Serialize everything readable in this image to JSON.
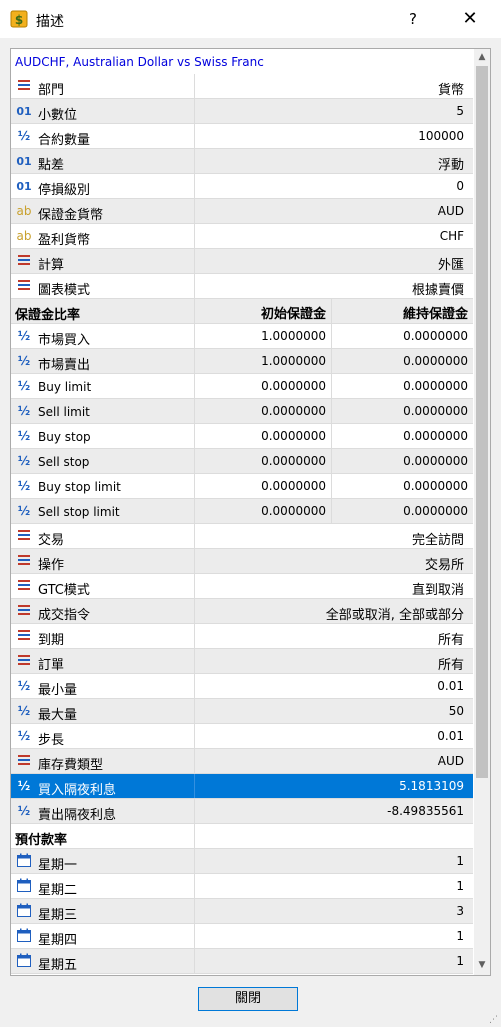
{
  "window": {
    "title": "描述",
    "help": "?",
    "close": "✕"
  },
  "symbol_header": "AUDCHF, Australian Dollar vs Swiss Franc",
  "rows_top": [
    {
      "icon": "list-icon",
      "label": "部門",
      "value": "貨幣"
    },
    {
      "icon": "integer-icon",
      "label": "小數位",
      "value": "5"
    },
    {
      "icon": "fraction-icon",
      "label": "合約數量",
      "value": "100000"
    },
    {
      "icon": "integer-icon",
      "label": "點差",
      "value": "浮動"
    },
    {
      "icon": "integer-icon",
      "label": "停損級別",
      "value": "0"
    },
    {
      "icon": "text-icon",
      "label": "保證金貨幣",
      "value": "AUD"
    },
    {
      "icon": "text-icon",
      "label": "盈利貨幣",
      "value": "CHF"
    },
    {
      "icon": "list-icon",
      "label": "計算",
      "value": "外匯"
    },
    {
      "icon": "list-icon",
      "label": "圖表模式",
      "value": "根據賣價"
    }
  ],
  "margin_section": {
    "title": "保證金比率",
    "col_initial": "初始保證金",
    "col_maintenance": "維持保證金",
    "rows": [
      {
        "label": "市場買入",
        "initial": "1.0000000",
        "maintenance": "0.0000000"
      },
      {
        "label": "市場賣出",
        "initial": "1.0000000",
        "maintenance": "0.0000000"
      },
      {
        "label": "Buy limit",
        "initial": "0.0000000",
        "maintenance": "0.0000000"
      },
      {
        "label": "Sell limit",
        "initial": "0.0000000",
        "maintenance": "0.0000000"
      },
      {
        "label": "Buy stop",
        "initial": "0.0000000",
        "maintenance": "0.0000000"
      },
      {
        "label": "Sell stop",
        "initial": "0.0000000",
        "maintenance": "0.0000000"
      },
      {
        "label": "Buy stop limit",
        "initial": "0.0000000",
        "maintenance": "0.0000000"
      },
      {
        "label": "Sell stop limit",
        "initial": "0.0000000",
        "maintenance": "0.0000000"
      }
    ]
  },
  "rows_mid": [
    {
      "icon": "list-icon",
      "label": "交易",
      "value": "完全訪問"
    },
    {
      "icon": "list-icon",
      "label": "操作",
      "value": "交易所"
    },
    {
      "icon": "list-icon",
      "label": "GTC模式",
      "value": "直到取消"
    },
    {
      "icon": "list-icon",
      "label": "成交指令",
      "value": "全部或取消, 全部或部分"
    },
    {
      "icon": "list-icon",
      "label": "到期",
      "value": "所有"
    },
    {
      "icon": "list-icon",
      "label": "訂單",
      "value": "所有"
    },
    {
      "icon": "fraction-icon",
      "label": "最小量",
      "value": "0.01"
    },
    {
      "icon": "fraction-icon",
      "label": "最大量",
      "value": "50"
    },
    {
      "icon": "fraction-icon",
      "label": "步長",
      "value": "0.01"
    },
    {
      "icon": "list-icon",
      "label": "庫存費類型",
      "value": "AUD"
    },
    {
      "icon": "fraction-icon",
      "label": "買入隔夜利息",
      "value": "5.1813109"
    },
    {
      "icon": "fraction-icon",
      "label": "賣出隔夜利息",
      "value": "-8.49835561"
    }
  ],
  "prepay_section": {
    "title": "預付款率"
  },
  "rows_days": [
    {
      "icon": "calendar-icon",
      "label": "星期一",
      "value": "1"
    },
    {
      "icon": "calendar-icon",
      "label": "星期二",
      "value": "1"
    },
    {
      "icon": "calendar-icon",
      "label": "星期三",
      "value": "3"
    },
    {
      "icon": "calendar-icon",
      "label": "星期四",
      "value": "1"
    },
    {
      "icon": "calendar-icon",
      "label": "星期五",
      "value": "1"
    }
  ],
  "close_button": "關閉"
}
